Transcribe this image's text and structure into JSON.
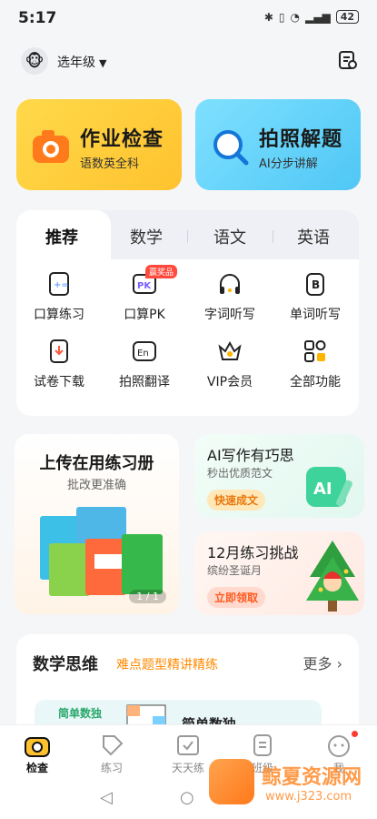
{
  "status": {
    "time": "5:17",
    "battery": "42"
  },
  "header": {
    "grade_label": "选年级"
  },
  "top_cards": [
    {
      "title": "作业检查",
      "subtitle": "语数英全科"
    },
    {
      "title": "拍照解题",
      "subtitle": "AI分步讲解"
    }
  ],
  "tabs": [
    "推荐",
    "数学",
    "语文",
    "英语"
  ],
  "tools": [
    {
      "label": "口算练习"
    },
    {
      "label": "口算PK",
      "badge": "赢奖品"
    },
    {
      "label": "字词听写"
    },
    {
      "label": "单词听写"
    },
    {
      "label": "试卷下载"
    },
    {
      "label": "拍照翻译"
    },
    {
      "label": "VIP会员"
    },
    {
      "label": "全部功能"
    }
  ],
  "upload_card": {
    "title": "上传在用练习册",
    "subtitle": "批改更准确",
    "pager": "1 / 1"
  },
  "ai_card": {
    "title": "AI写作有巧思",
    "subtitle": "秒出优质范文",
    "button": "快速成文"
  },
  "challenge_card": {
    "title": "12月练习挑战",
    "subtitle": "缤纷圣诞月",
    "button": "立即领取"
  },
  "math_section": {
    "title": "数学思维",
    "subtitle": "难点题型精讲精练",
    "more": "更多",
    "item_label": "简单数独",
    "item_name": "简单数独"
  },
  "bottom_nav": [
    "检查",
    "练习",
    "天天练",
    "班级",
    "我"
  ],
  "watermark": {
    "text": "鲸夏资源网",
    "url": "www.j323.com"
  },
  "colors": {
    "yellow": "#ffc22e",
    "blue": "#4fc7f5",
    "orange": "#ff8a00"
  }
}
